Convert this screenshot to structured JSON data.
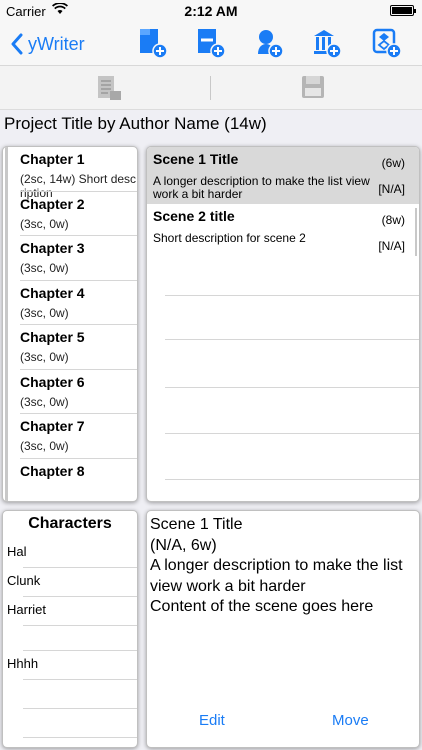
{
  "status": {
    "carrier": "Carrier",
    "time": "2:12 AM"
  },
  "nav": {
    "back_label": "yWriter",
    "icons": [
      "add-chapter-icon",
      "remove-chapter-icon",
      "add-character-icon",
      "add-location-icon",
      "add-item-icon"
    ],
    "accent": "#1a7cf5"
  },
  "toolbar": {
    "icons": [
      "export-document-icon",
      "save-icon"
    ]
  },
  "project": {
    "title": "Project Title by Author Name (14w)"
  },
  "chapters": [
    {
      "name": "Chapter 1",
      "desc": "(2sc, 14w) Short description"
    },
    {
      "name": "Chapter 2",
      "desc": "(3sc, 0w)"
    },
    {
      "name": "Chapter 3",
      "desc": "(3sc, 0w)"
    },
    {
      "name": "Chapter 4",
      "desc": "(3sc, 0w)"
    },
    {
      "name": "Chapter 5",
      "desc": "(3sc, 0w)"
    },
    {
      "name": "Chapter 6",
      "desc": "(3sc, 0w)"
    },
    {
      "name": "Chapter 7",
      "desc": "(3sc, 0w)"
    },
    {
      "name": "Chapter 8",
      "desc": ""
    }
  ],
  "scenes": [
    {
      "title": "Scene 1 Title",
      "words": "(6w)",
      "desc": "A longer description to make the list view work a bit harder",
      "status": "[N/A]",
      "selected": true
    },
    {
      "title": "Scene 2 title",
      "words": "(8w)",
      "desc": "Short description for scene 2",
      "status": "[N/A]",
      "selected": false
    }
  ],
  "characters": {
    "header": "Characters",
    "items": [
      "Hal",
      "Clunk",
      "Harriet",
      "",
      "Hhhh",
      "",
      ""
    ]
  },
  "detail": {
    "title": "Scene 1 Title",
    "meta": "(N/A, 6w)",
    "desc": "A longer description to make the list view work a bit harder",
    "content": "Content of the scene goes here",
    "edit_label": "Edit",
    "move_label": "Move"
  }
}
